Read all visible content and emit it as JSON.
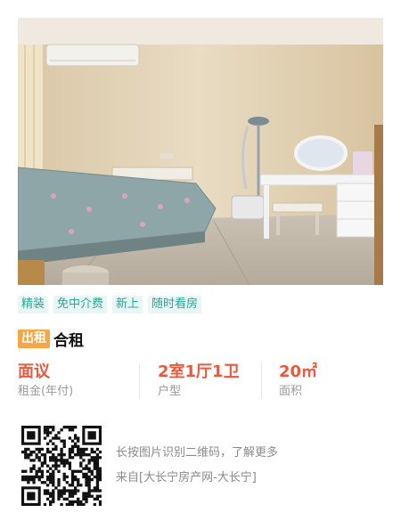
{
  "listing": {
    "tags": [
      "精装",
      "免中介费",
      "新上",
      "随时看房"
    ],
    "rent_badge": "出租",
    "rent_type": "合租",
    "stats": [
      {
        "value": "面议",
        "label": "租金(年付)"
      },
      {
        "value": "2室1厅1卫",
        "label": "户型"
      },
      {
        "value": "20㎡",
        "label": "面积"
      }
    ]
  },
  "qr": {
    "hint": "长按图片识别二维码，了解更多",
    "source": "来自[大长宁房产网-大长宁]"
  },
  "colors": {
    "tag_bg": "#e8f6f4",
    "tag_text": "#2aa59a",
    "badge": "#f7a646",
    "accent": "#e85a3c"
  },
  "photo": {
    "icon": "room-photo"
  }
}
